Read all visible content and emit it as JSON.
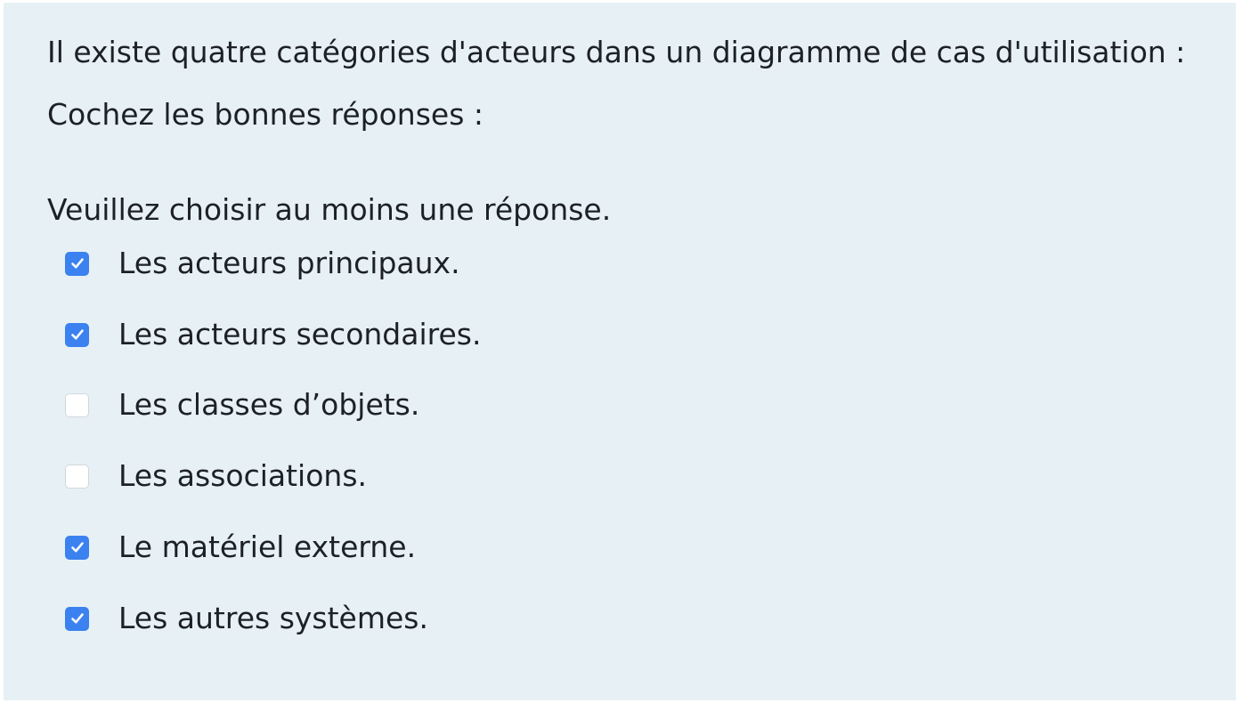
{
  "question": {
    "text": "Il existe quatre catégories d'acteurs dans un diagramme de cas d'utilisation :",
    "instruction": "Cochez les bonnes réponses :",
    "prompt": "Veuillez choisir au moins une réponse."
  },
  "options": [
    {
      "label": "Les acteurs principaux.",
      "checked": true
    },
    {
      "label": "Les acteurs secondaires.",
      "checked": true
    },
    {
      "label": "Les classes d’objets.",
      "checked": false
    },
    {
      "label": "Les associations.",
      "checked": false
    },
    {
      "label": "Le matériel externe.",
      "checked": true
    },
    {
      "label": "Les autres systèmes.",
      "checked": true
    }
  ],
  "colors": {
    "panel_bg": "#e7f1f5",
    "text": "#1d2125",
    "checkbox_checked": "#3b82f0",
    "checkbox_unchecked_border": "#d3d7dc"
  },
  "icons": {
    "checked": "check-icon"
  }
}
